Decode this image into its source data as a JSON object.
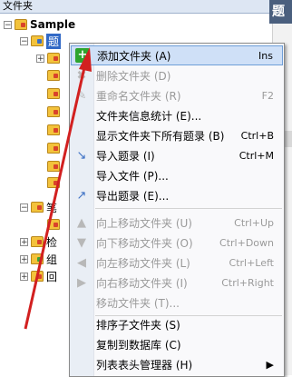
{
  "pane": {
    "title": "文件夹",
    "right_header": "题 支"
  },
  "tree": {
    "root": "Sample",
    "selected": "题",
    "partial_2": "笔",
    "partial_3": "检",
    "partial_4": "组",
    "partial_5": "回"
  },
  "menu": {
    "items": [
      {
        "label": "添加文件夹 (A)",
        "shortcut": "Ins",
        "icon": "add-folder-icon",
        "enabled": true
      },
      {
        "label": "删除文件夹 (D)",
        "shortcut": "",
        "icon": "delete-folder-icon",
        "enabled": false
      },
      {
        "label": "重命名文件夹 (R)",
        "shortcut": "F2",
        "icon": "rename-icon",
        "enabled": false
      },
      {
        "label": "文件夹信息统计 (E)...",
        "shortcut": "",
        "icon": "",
        "enabled": true
      },
      {
        "label": "显示文件夹下所有题录 (B)",
        "shortcut": "Ctrl+B",
        "icon": "",
        "enabled": true
      },
      {
        "label": "导入题录 (I)",
        "shortcut": "Ctrl+M",
        "icon": "import-icon",
        "enabled": true
      },
      {
        "label": "导入文件 (P)...",
        "shortcut": "",
        "icon": "",
        "enabled": true
      },
      {
        "label": "导出题录 (E)...",
        "shortcut": "",
        "icon": "export-icon",
        "enabled": true
      },
      {
        "label": "向上移动文件夹 (U)",
        "shortcut": "Ctrl+Up",
        "icon": "move-up-icon",
        "enabled": false
      },
      {
        "label": "向下移动文件夹 (O)",
        "shortcut": "Ctrl+Down",
        "icon": "move-down-icon",
        "enabled": false
      },
      {
        "label": "向左移动文件夹 (L)",
        "shortcut": "Ctrl+Left",
        "icon": "move-left-icon",
        "enabled": false
      },
      {
        "label": "向右移动文件夹 (I)",
        "shortcut": "Ctrl+Right",
        "icon": "move-right-icon",
        "enabled": false
      },
      {
        "label": "移动文件夹 (T)...",
        "shortcut": "",
        "icon": "",
        "enabled": false
      },
      {
        "label": "排序子文件夹 (S)",
        "shortcut": "",
        "icon": "",
        "enabled": true
      },
      {
        "label": "复制到数据库 (C)",
        "shortcut": "",
        "icon": "",
        "enabled": true
      },
      {
        "label": "列表表头管理器 (H)",
        "shortcut": "▶",
        "icon": "",
        "enabled": true
      }
    ]
  },
  "colors": {
    "highlight": "#cfe0f7",
    "arrow": "#d22020",
    "disabled_text": "#9a9a9a"
  }
}
